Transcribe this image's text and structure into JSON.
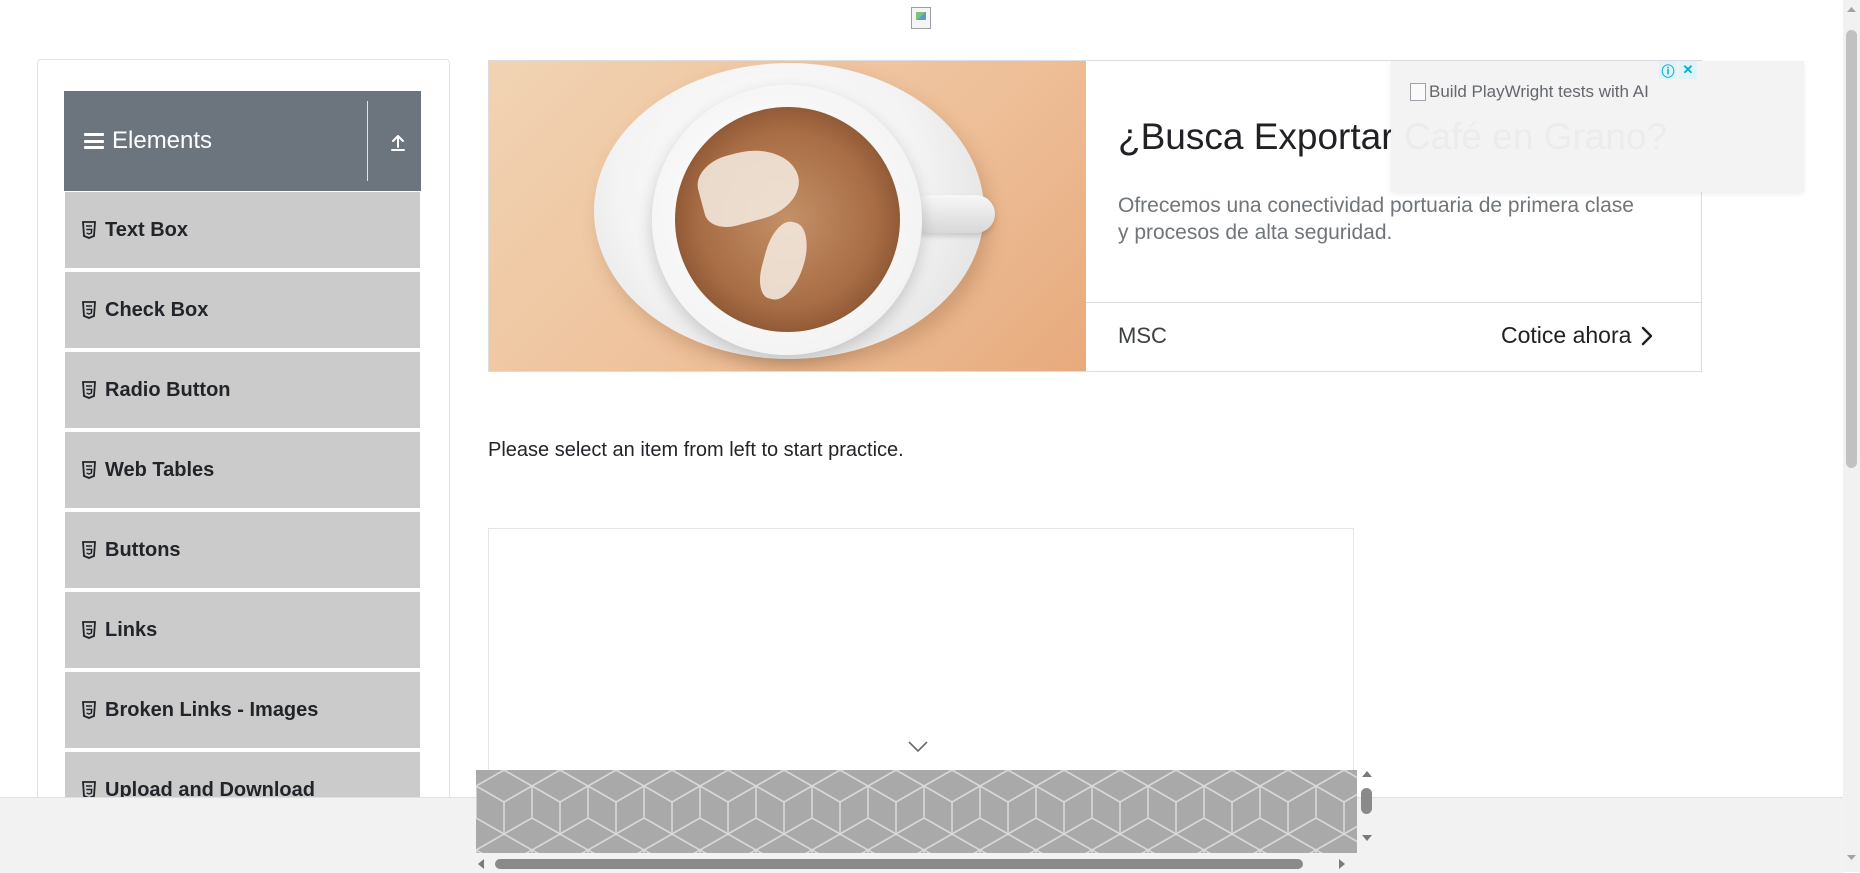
{
  "header": {
    "logo_alt": ""
  },
  "sidebar": {
    "group": {
      "title": "Elements"
    },
    "items": [
      {
        "label": "Text Box"
      },
      {
        "label": "Check Box"
      },
      {
        "label": "Radio Button"
      },
      {
        "label": "Web Tables"
      },
      {
        "label": "Buttons"
      },
      {
        "label": "Links"
      },
      {
        "label": "Broken Links - Images"
      },
      {
        "label": "Upload and Download"
      }
    ]
  },
  "ad": {
    "headline": "¿Busca Exportar Café en Grano?",
    "body": "Ofrecemos una conectividad portuaria de primera clase y procesos de alta seguridad.",
    "brand": "MSC",
    "cta": "Cotice ahora",
    "info_badge": "ⓘ",
    "close_badge": "✕"
  },
  "ad_overlay": {
    "text": "Build PlayWright tests with AI"
  },
  "main": {
    "instruction": "Please select an item from left to start practice."
  },
  "colors": {
    "group_header_bg": "#6c757d",
    "menu_item_bg": "#cbcbcb",
    "ad_badge_color": "#00aecd",
    "sticky_ad_bg": "#a9a9a9"
  },
  "icons": {
    "menu_item": "html5-icon",
    "group": "hamburger-icon",
    "collapse": "upload-arrow-icon",
    "cta": "chevron-right-icon",
    "scroll_hint": "chevron-down-icon"
  }
}
